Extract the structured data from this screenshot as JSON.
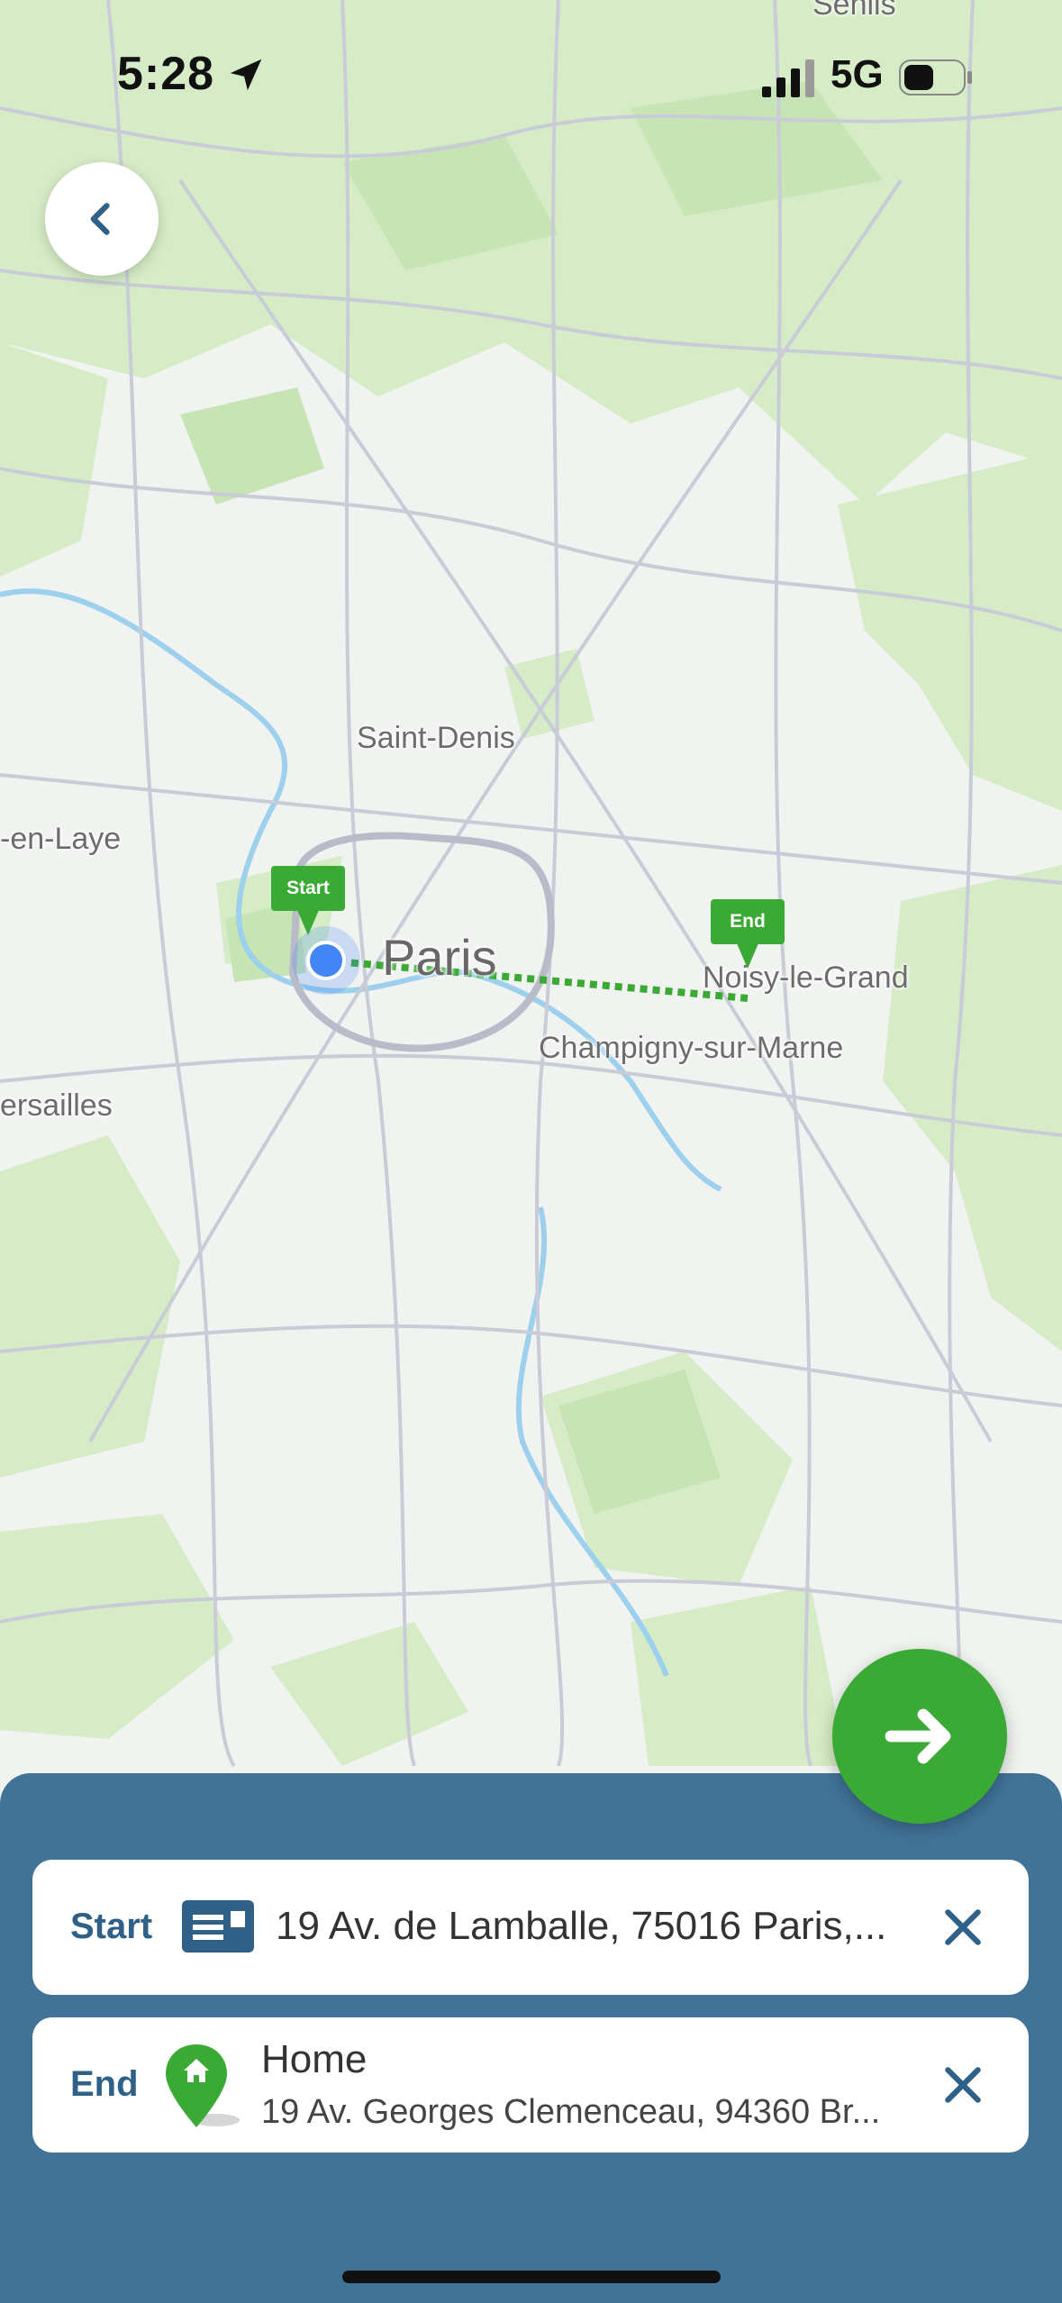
{
  "status_bar": {
    "time": "5:28",
    "network": "5G",
    "icons": [
      "location-arrow-icon",
      "signal-bars-icon",
      "battery-icon"
    ]
  },
  "map": {
    "labels": {
      "senlis": "Senlis",
      "saint_denis": "Saint-Denis",
      "en_laye": "-en-Laye",
      "paris": "Paris",
      "noisy": "Noisy-le-Grand",
      "champigny": "Champigny-sur-Marne",
      "versailles": "ersailles"
    },
    "start_pin": "Start",
    "end_pin": "End",
    "route_color": "#3aaa35"
  },
  "route_panel": {
    "start": {
      "label": "Start",
      "address": "19 Av. de Lamballe, 75016 Paris,..."
    },
    "end": {
      "label": "End",
      "name": "Home",
      "address": "19 Av. Georges Clemenceau, 94360 Br..."
    }
  },
  "colors": {
    "panel": "#417399",
    "accent_green": "#3aaa35",
    "label_blue": "#2f6188"
  }
}
